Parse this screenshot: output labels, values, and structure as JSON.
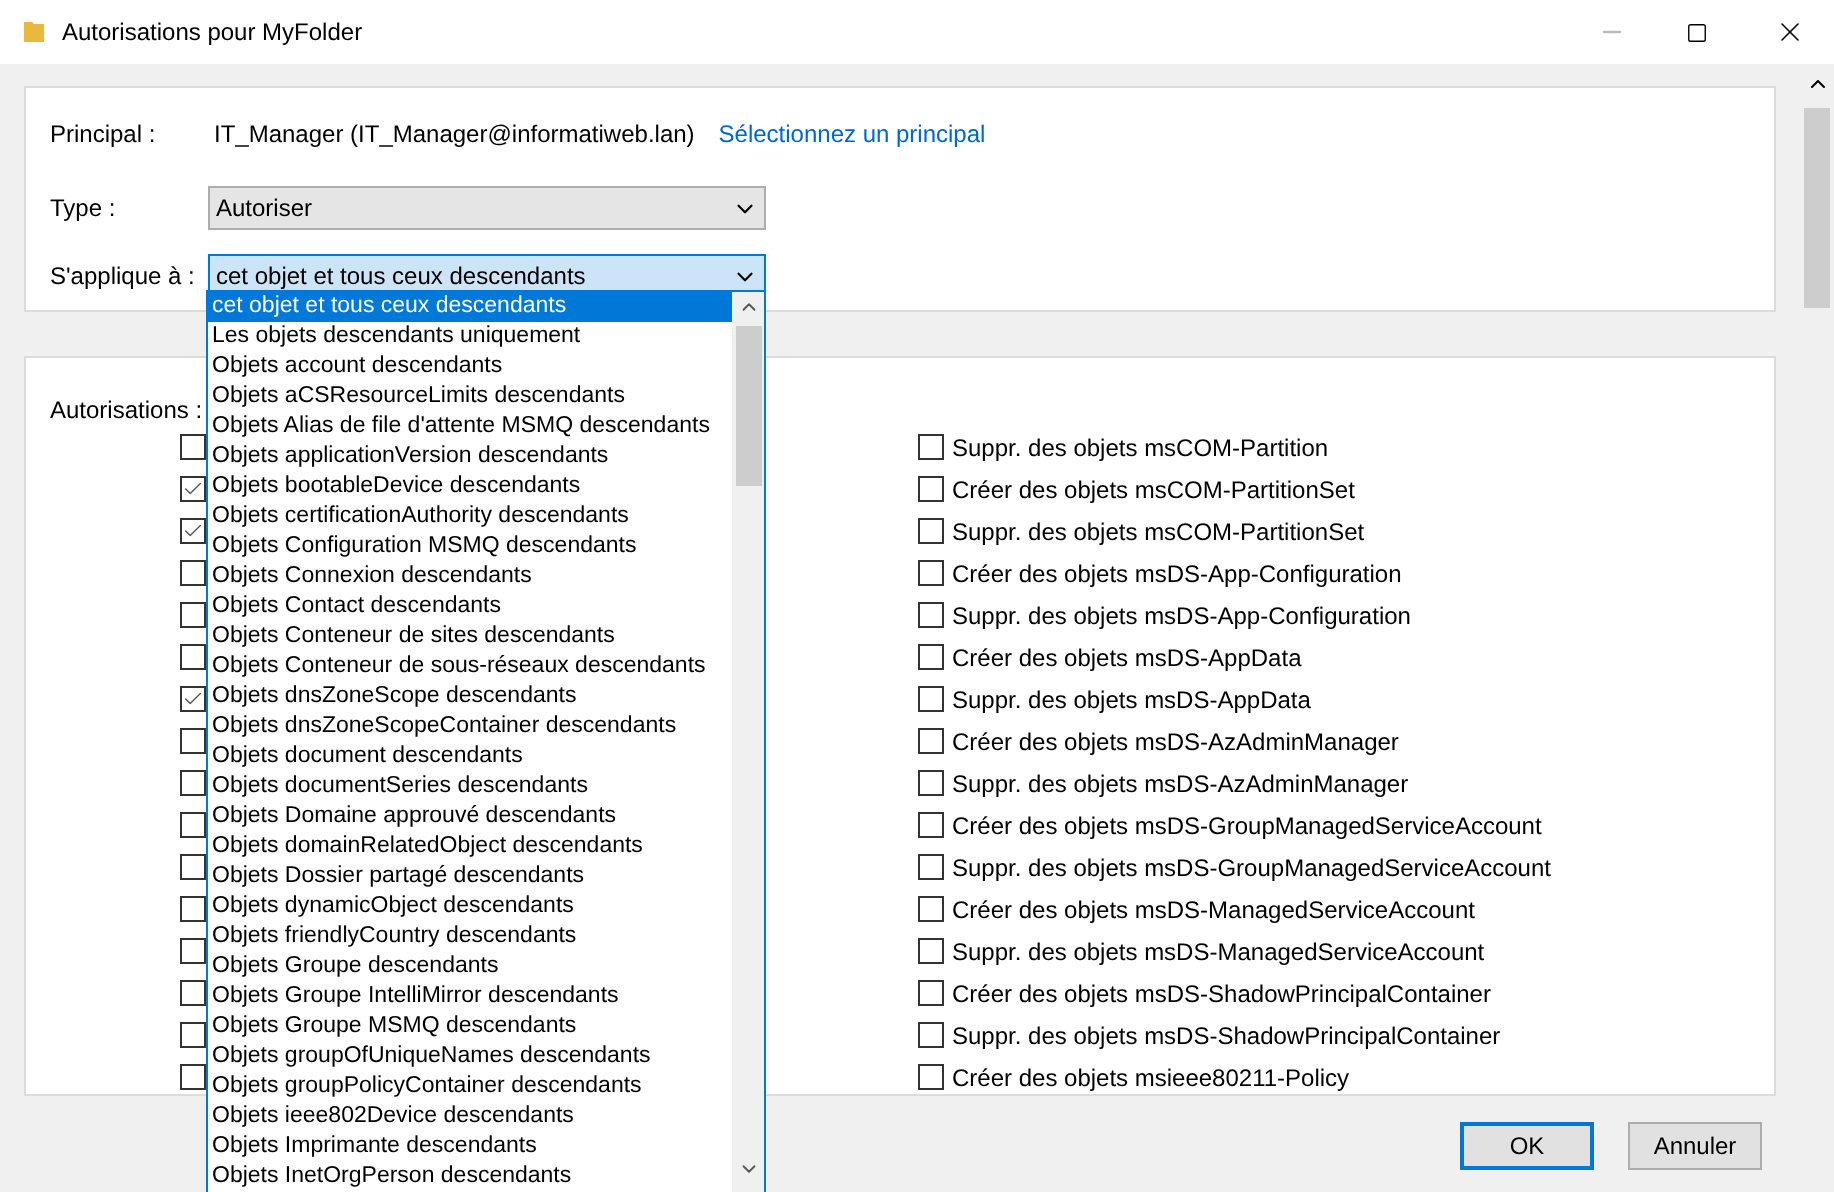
{
  "window": {
    "title": "Autorisations pour MyFolder"
  },
  "principal": {
    "label": "Principal :",
    "value": "IT_Manager (IT_Manager@informatiweb.lan)",
    "link": "Sélectionnez un principal"
  },
  "type": {
    "label": "Type :",
    "value": "Autoriser"
  },
  "applies_to": {
    "label": "S'applique à :",
    "value": "cet objet et tous ceux descendants",
    "options": [
      {
        "label": "cet objet et tous ceux descendants",
        "selected": true
      },
      {
        "label": "Les objets descendants uniquement",
        "selected": false
      },
      {
        "label": "Objets account descendants",
        "selected": false
      },
      {
        "label": "Objets aCSResourceLimits descendants",
        "selected": false
      },
      {
        "label": "Objets Alias de file d'attente MSMQ descendants",
        "selected": false
      },
      {
        "label": "Objets applicationVersion descendants",
        "selected": false
      },
      {
        "label": "Objets bootableDevice descendants",
        "selected": false
      },
      {
        "label": "Objets certificationAuthority descendants",
        "selected": false
      },
      {
        "label": "Objets Configuration MSMQ descendants",
        "selected": false
      },
      {
        "label": "Objets Connexion descendants",
        "selected": false
      },
      {
        "label": "Objets Contact descendants",
        "selected": false
      },
      {
        "label": "Objets Conteneur de sites descendants",
        "selected": false
      },
      {
        "label": "Objets Conteneur de sous-réseaux descendants",
        "selected": false
      },
      {
        "label": "Objets dnsZoneScope descendants",
        "selected": false
      },
      {
        "label": "Objets dnsZoneScopeContainer descendants",
        "selected": false
      },
      {
        "label": "Objets document descendants",
        "selected": false
      },
      {
        "label": "Objets documentSeries descendants",
        "selected": false
      },
      {
        "label": "Objets Domaine approuvé descendants",
        "selected": false
      },
      {
        "label": "Objets domainRelatedObject descendants",
        "selected": false
      },
      {
        "label": "Objets Dossier partagé  descendants",
        "selected": false
      },
      {
        "label": "Objets dynamicObject descendants",
        "selected": false
      },
      {
        "label": "Objets friendlyCountry descendants",
        "selected": false
      },
      {
        "label": "Objets Groupe descendants",
        "selected": false
      },
      {
        "label": "Objets Groupe IntelliMirror descendants",
        "selected": false
      },
      {
        "label": "Objets Groupe MSMQ descendants",
        "selected": false
      },
      {
        "label": "Objets groupOfUniqueNames descendants",
        "selected": false
      },
      {
        "label": "Objets groupPolicyContainer descendants",
        "selected": false
      },
      {
        "label": "Objets ieee802Device descendants",
        "selected": false
      },
      {
        "label": "Objets Imprimante descendants",
        "selected": false
      },
      {
        "label": "Objets InetOrgPerson descendants",
        "selected": false
      }
    ]
  },
  "permissions": {
    "label": "Autorisations :",
    "left_column": [
      {
        "checked": false
      },
      {
        "checked": true
      },
      {
        "checked": true
      },
      {
        "checked": false
      },
      {
        "checked": false
      },
      {
        "checked": false
      },
      {
        "checked": true
      },
      {
        "checked": false
      },
      {
        "checked": false
      },
      {
        "checked": false
      },
      {
        "checked": false
      },
      {
        "checked": false
      },
      {
        "checked": false
      },
      {
        "checked": false
      },
      {
        "checked": false
      },
      {
        "checked": false
      }
    ],
    "right_column": [
      {
        "label": "Suppr. des objets msCOM-Partition",
        "checked": false
      },
      {
        "label": "Créer des objets msCOM-PartitionSet",
        "checked": false
      },
      {
        "label": "Suppr. des objets msCOM-PartitionSet",
        "checked": false
      },
      {
        "label": "Créer des objets msDS-App-Configuration",
        "checked": false
      },
      {
        "label": "Suppr. des objets msDS-App-Configuration",
        "checked": false
      },
      {
        "label": "Créer des objets msDS-AppData",
        "checked": false
      },
      {
        "label": "Suppr. des objets msDS-AppData",
        "checked": false
      },
      {
        "label": "Créer des objets msDS-AzAdminManager",
        "checked": false
      },
      {
        "label": "Suppr. des objets msDS-AzAdminManager",
        "checked": false
      },
      {
        "label": "Créer des objets msDS-GroupManagedServiceAccount",
        "checked": false
      },
      {
        "label": "Suppr. des objets msDS-GroupManagedServiceAccount",
        "checked": false
      },
      {
        "label": "Créer des objets msDS-ManagedServiceAccount",
        "checked": false
      },
      {
        "label": "Suppr. des objets msDS-ManagedServiceAccount",
        "checked": false
      },
      {
        "label": "Créer des objets msDS-ShadowPrincipalContainer",
        "checked": false
      },
      {
        "label": "Suppr. des objets msDS-ShadowPrincipalContainer",
        "checked": false
      },
      {
        "label": "Créer des objets msieee80211-Policy",
        "checked": false
      }
    ]
  },
  "buttons": [
    {
      "label": "OK",
      "default": true
    },
    {
      "label": "Annuler",
      "default": false
    }
  ]
}
